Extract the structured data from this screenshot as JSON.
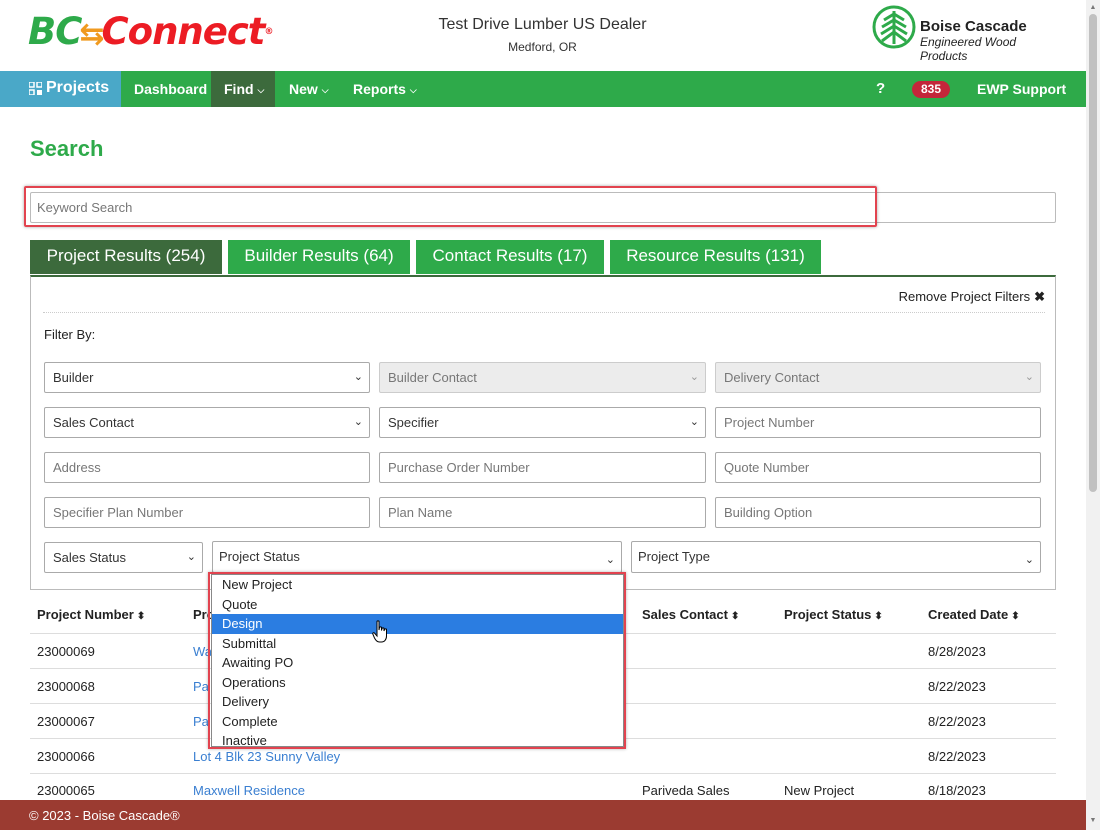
{
  "header": {
    "logo": {
      "bc": "BC",
      "connect": "Connect",
      "tm": "®"
    },
    "dealer_name": "Test Drive Lumber US Dealer",
    "dealer_location": "Medford, OR",
    "company_name": "Boise Cascade",
    "company_tagline": "Engineered Wood Products"
  },
  "nav": {
    "projects": "Projects",
    "dashboard": "Dashboard",
    "find": "Find",
    "new": "New",
    "reports": "Reports",
    "help": "?",
    "badge_count": "835",
    "support": "EWP Support"
  },
  "search": {
    "title": "Search",
    "keyword_placeholder": "Keyword Search"
  },
  "tabs": [
    {
      "label": "Project Results (254)"
    },
    {
      "label": "Builder Results (64)"
    },
    {
      "label": "Contact Results (17)"
    },
    {
      "label": "Resource Results (131)"
    }
  ],
  "filters": {
    "remove_label": "Remove Project Filters",
    "filter_by": "Filter By:",
    "builder": "Builder",
    "builder_contact": "Builder Contact",
    "delivery_contact": "Delivery Contact",
    "sales_contact": "Sales Contact",
    "specifier": "Specifier",
    "project_number": "Project Number",
    "address": "Address",
    "purchase_order_number": "Purchase Order Number",
    "quote_number": "Quote Number",
    "specifier_plan_number": "Specifier Plan Number",
    "plan_name": "Plan Name",
    "building_option": "Building Option",
    "sales_status": "Sales Status",
    "project_status": "Project Status",
    "project_type": "Project Type"
  },
  "status_options": [
    "New Project",
    "Quote",
    "Design",
    "Submittal",
    "Awaiting PO",
    "Operations",
    "Delivery",
    "Complete",
    "Inactive"
  ],
  "status_highlighted": "Design",
  "table": {
    "columns": {
      "project_number": "Project Number",
      "project_name_partial": "Pro",
      "sales_contact": "Sales Contact",
      "project_status": "Project Status",
      "created_date": "Created Date"
    },
    "rows": [
      {
        "number": "23000069",
        "name": "Wa",
        "sales_contact": "",
        "status": "",
        "date": "8/28/2023"
      },
      {
        "number": "23000068",
        "name": "Pa",
        "sales_contact": "",
        "status": "",
        "date": "8/22/2023"
      },
      {
        "number": "23000067",
        "name": "Pa",
        "sales_contact": "",
        "status": "",
        "date": "8/22/2023"
      },
      {
        "number": "23000066",
        "name": "Lot 4 Blk 23 Sunny Valley",
        "sales_contact": "",
        "status": "",
        "date": "8/22/2023"
      },
      {
        "number": "23000065",
        "name": "Maxwell Residence",
        "sales_contact": "Pariveda Sales",
        "status": "New Project",
        "date": "8/18/2023"
      }
    ]
  },
  "footer": {
    "text": "© 2023 - Boise Cascade®"
  },
  "colors": {
    "brand_green": "#2eaa4a",
    "dark_green": "#3c6a3c",
    "nav_blue": "#4aa8c8",
    "footer_red": "#9b3b31",
    "badge_red": "#c3263a",
    "highlight": "#e2434f",
    "selection_blue": "#2b7de1"
  }
}
